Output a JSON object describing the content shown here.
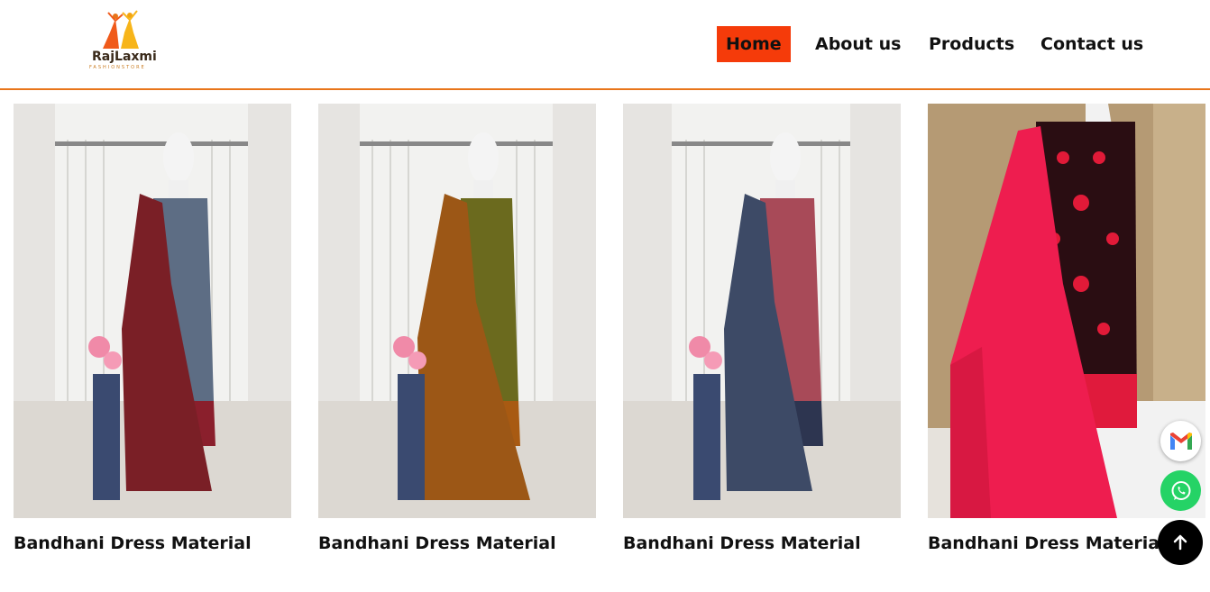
{
  "header": {
    "logo_text": "RajLaxmi",
    "logo_subtext": "FASHIONSTORE",
    "nav": [
      {
        "label": "Home",
        "active": true
      },
      {
        "label": "About us"
      },
      {
        "label": "Products"
      },
      {
        "label": "Contact us"
      }
    ]
  },
  "products": [
    {
      "title": "Bandhani Dress Material",
      "image": "maroon-grey-dress-material"
    },
    {
      "title": "Bandhani Dress Material",
      "image": "mustard-brown-dress-material"
    },
    {
      "title": "Bandhani Dress Material",
      "image": "navy-maroon-dress-material"
    },
    {
      "title": "Bandhani Dress Material",
      "image": "red-black-bandhani-dress"
    }
  ],
  "floating_buttons": [
    {
      "name": "gmail-button",
      "icon": "gmail-icon"
    },
    {
      "name": "whatsapp-button",
      "icon": "whatsapp-icon"
    },
    {
      "name": "scroll-top-button",
      "icon": "arrow-up-icon"
    }
  ],
  "colors": {
    "accent": "#f53b0a",
    "header_border": "#e8751a",
    "whatsapp": "#25d366",
    "scroll_top": "#000000"
  }
}
